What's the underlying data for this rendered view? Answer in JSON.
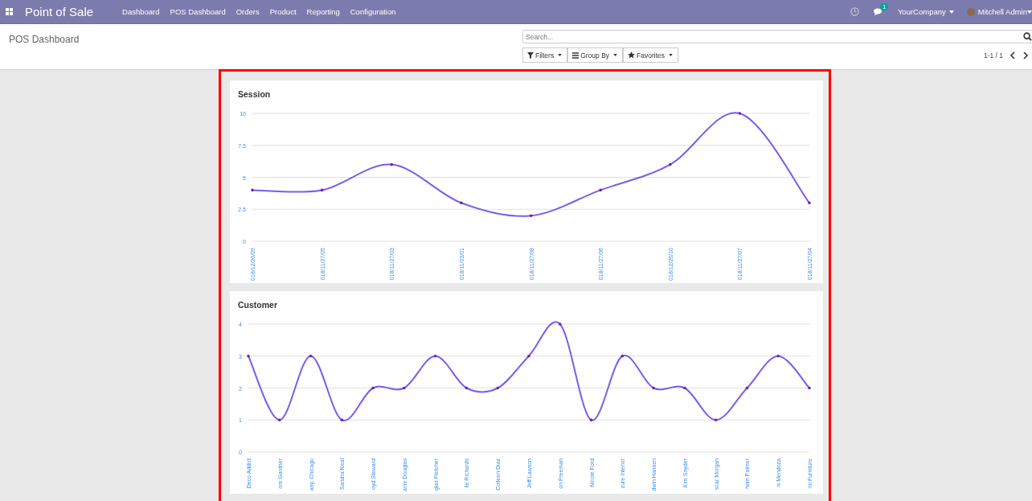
{
  "navbar": {
    "app_title": "Point of Sale",
    "menu": [
      "Dashboard",
      "POS Dashboard",
      "Orders",
      "Product",
      "Reporting",
      "Configuration"
    ],
    "messages_badge": "1",
    "company": "YourCompany",
    "user": "Mitchell Admin"
  },
  "control_panel": {
    "breadcrumb": "POS Dashboard",
    "search": {
      "placeholder": "Search..."
    },
    "filters": [
      "Filters",
      "Group By",
      "Favorites"
    ],
    "pager": "1-1 / 1"
  },
  "charts": [
    {
      "title": "Session",
      "chart_data": {
        "type": "line",
        "categories": [
          "018/12/26/09",
          "018/11/27/05",
          "018/11/27/03",
          "018/11/03/01",
          "018/11/27/08",
          "018/11/27/06",
          "018/12/26/10",
          "018/11/27/07",
          "018/11/27/04"
        ],
        "series": [
          {
            "color": "#7b5cf0",
            "values": [
              4,
              4,
              6,
              3,
              2,
              4,
              6,
              10,
              3
            ]
          }
        ],
        "grid": true,
        "ylim": [
          0,
          10
        ],
        "yticks": [
          0,
          {
            "value": 2.5,
            "label": "2.5"
          },
          5,
          {
            "value": 7.5,
            "label": "7.5"
          },
          10
        ]
      }
    },
    {
      "title": "Customer",
      "chart_data": {
        "type": "line",
        "categories": [
          "Deco Addict",
          "ore Gardner",
          "any, Chicago",
          "Sandra Neal",
          "oyd Steward",
          "aine Douglas",
          "glas Fletcher",
          "lie Richards",
          "Colleen Diaz",
          "Jeff Lawson",
          "on Freeman",
          "Nicole Ford",
          "zure Interior",
          "dwin Hansen",
          "Kim Snyder",
          "scar Morgan",
          "ham Palmer",
          "is Mendoza",
          "ini Furniture"
        ],
        "series": [
          {
            "color": "#7b5cf0",
            "values": [
              3,
              1,
              3,
              1,
              2,
              2,
              3,
              2,
              2,
              3,
              4,
              1,
              3,
              2,
              2,
              1,
              2,
              3,
              2
            ]
          }
        ],
        "grid": true,
        "ylim": [
          0,
          4
        ],
        "yticks": [
          0,
          1,
          2,
          3,
          4
        ]
      }
    }
  ]
}
